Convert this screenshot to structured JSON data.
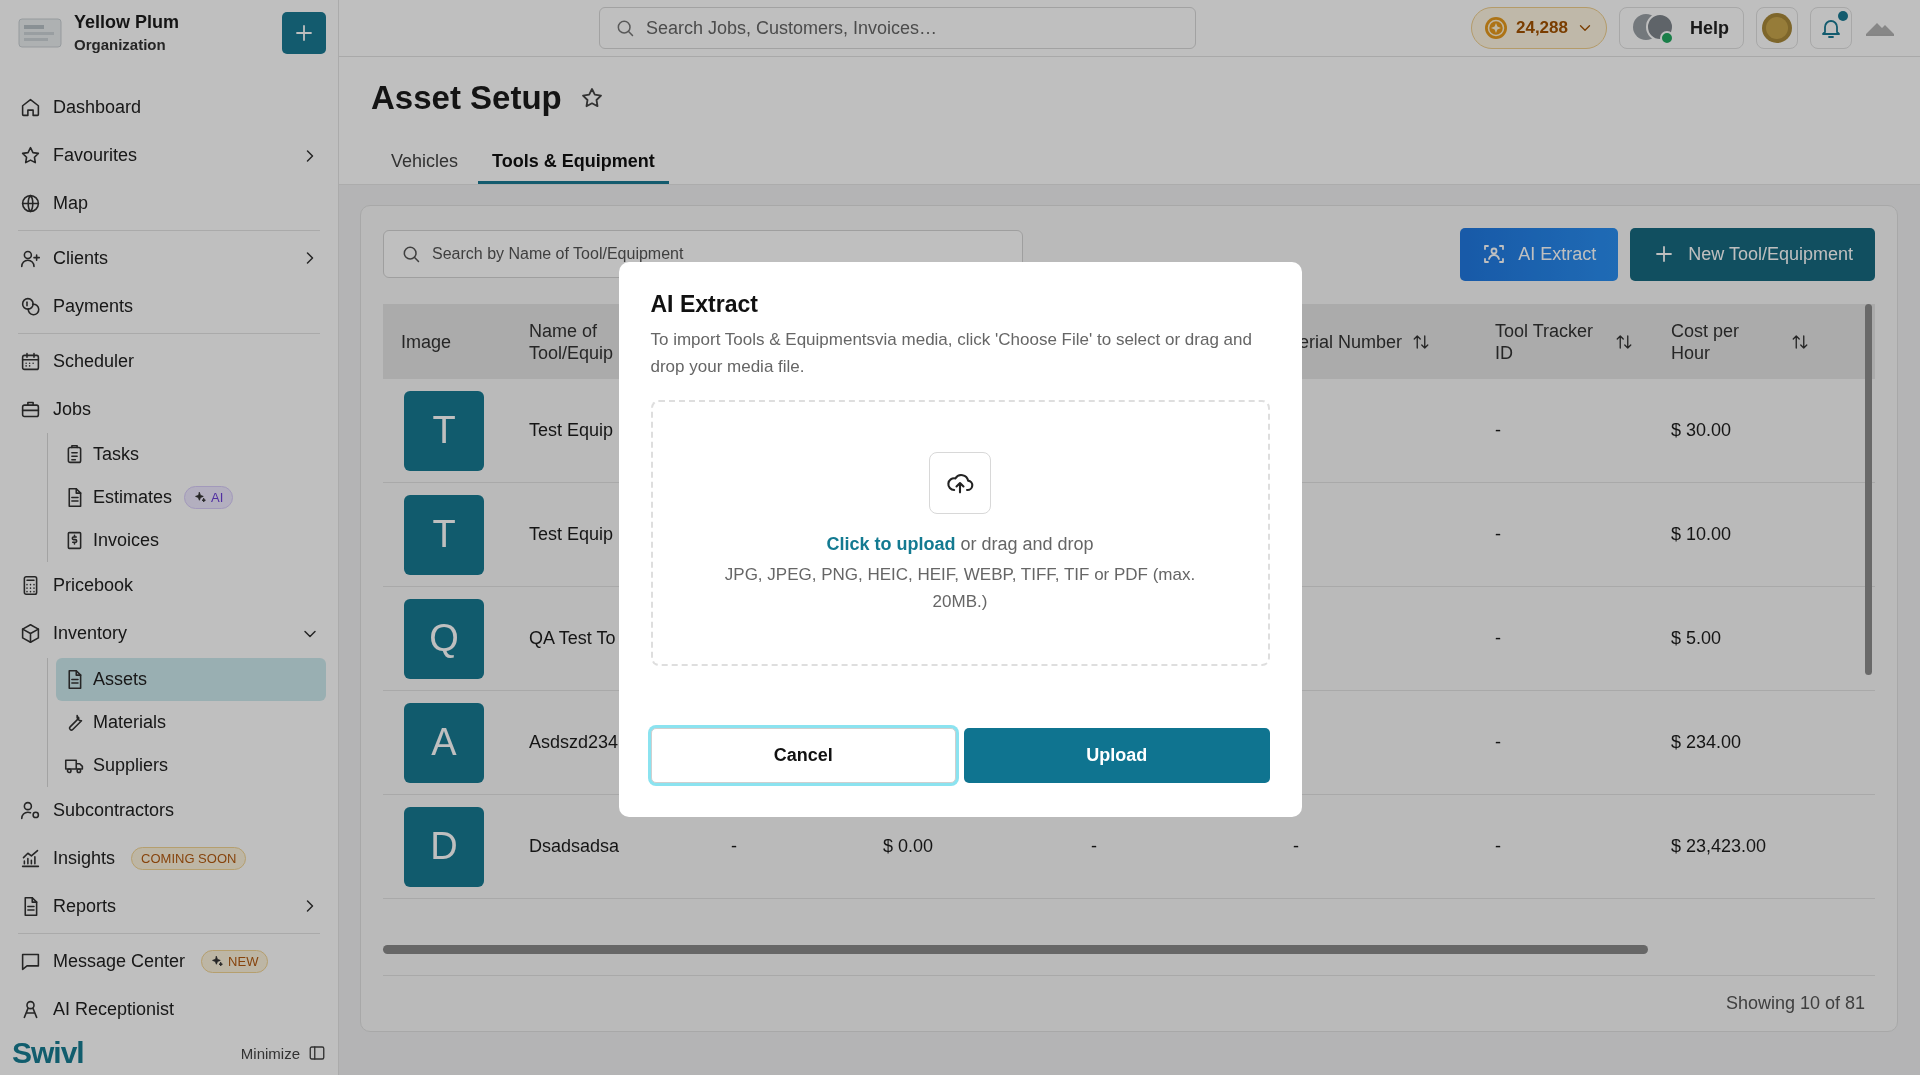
{
  "sidebar": {
    "organization": {
      "name": "Yellow Plum",
      "subtitle": "Organization"
    },
    "sections": [
      {
        "items": [
          {
            "label": "Dashboard",
            "selected": false
          },
          {
            "label": "Favourites",
            "selected": false,
            "expanded": false
          },
          {
            "label": "Map",
            "selected": false
          }
        ]
      },
      {
        "items": [
          {
            "label": "Clients",
            "selected": false,
            "expanded": false
          },
          {
            "label": "Payments",
            "selected": false
          }
        ]
      },
      {
        "items": [
          {
            "label": "Scheduler",
            "selected": false
          },
          {
            "label": "Jobs",
            "selected": false,
            "children": [
              {
                "label": "Tasks",
                "selected": false
              },
              {
                "label": "Estimates",
                "selected": false,
                "badge": {
                  "text": "AI",
                  "kind": "ai"
                }
              },
              {
                "label": "Invoices",
                "selected": false
              }
            ]
          },
          {
            "label": "Pricebook",
            "selected": false
          },
          {
            "label": "Inventory",
            "selected": false,
            "expanded": true,
            "children": [
              {
                "label": "Assets",
                "selected": true
              },
              {
                "label": "Materials",
                "selected": false
              },
              {
                "label": "Suppliers",
                "selected": false
              }
            ]
          },
          {
            "label": "Subcontractors",
            "selected": false
          },
          {
            "label": "Insights",
            "selected": false,
            "badge": {
              "text": "COMING SOON",
              "kind": "soon"
            }
          },
          {
            "label": "Reports",
            "selected": false,
            "expanded": false
          }
        ]
      },
      {
        "items": [
          {
            "label": "Message Center",
            "selected": false,
            "badge": {
              "text": "NEW",
              "kind": "new"
            }
          },
          {
            "label": "AI Receptionist",
            "selected": false
          }
        ]
      }
    ],
    "logo": "Swivl",
    "minimize": "Minimize"
  },
  "topbar": {
    "search": {
      "placeholder": "Search Jobs, Customers, Invoices…"
    },
    "points": "24,288",
    "help": "Help",
    "notifications": {
      "unread": true
    }
  },
  "page": {
    "title": "Asset Setup",
    "favourite": false
  },
  "tabs": [
    {
      "label": "Vehicles",
      "selected": false
    },
    {
      "label": "Tools & Equipment",
      "selected": true
    }
  ],
  "toolbar": {
    "search": {
      "placeholder": "Search by Name of Tool/Equipment"
    },
    "buttons": [
      {
        "label": "AI Extract",
        "kind": "ai"
      },
      {
        "label": "New Tool/Equipment",
        "kind": "new"
      }
    ]
  },
  "table": {
    "columns": {
      "image": {
        "label": "Image",
        "sortable": false
      },
      "name": {
        "label": "Name of Tool/Equip",
        "sortable": false
      },
      "serial_number": {
        "label": "erial Number",
        "sortable": true
      },
      "tool_tracker_id": {
        "label": "Tool Tracker ID",
        "sortable": true
      },
      "cost_per_hour": {
        "label": "Cost per Hour",
        "sortable": true
      }
    },
    "rows": [
      {
        "image": "T",
        "name": "Test Equip",
        "tool_tracker_id": "-",
        "cost_per_hour": "$ 30.00"
      },
      {
        "image": "T",
        "name": "Test Equip",
        "tool_tracker_id": "-",
        "cost_per_hour": "$ 10.00"
      },
      {
        "image": "Q",
        "name": "QA Test To",
        "tool_tracker_id": "-",
        "cost_per_hour": "$ 5.00"
      },
      {
        "image": "A",
        "name": "Asdszd234",
        "tool_tracker_id": "-",
        "cost_per_hour": "$ 234.00"
      },
      {
        "image": "D",
        "name": "Dsadsadsa",
        "column_3": "-",
        "column_4": "$ 0.00",
        "column_5": "-",
        "serial_number": "-",
        "tool_tracker_id": "-",
        "cost_per_hour": "$ 23,423.00"
      }
    ],
    "footer": "Showing 10 of 81"
  },
  "dialog": {
    "title": "AI Extract",
    "description": "To import Tools & Equipmentsvia media, click 'Choose File' to select or drag and drop your media file.",
    "dropzone": {
      "link": "Click to upload",
      "text": "or drag and drop",
      "hint": "JPG, JPEG, PNG, HEIC, HEIF, WEBP, TIFF, TIF or PDF (max. 20MB.)"
    },
    "buttons": [
      {
        "label": "Cancel",
        "kind": "secondary",
        "focused": true
      },
      {
        "label": "Upload",
        "kind": "primary",
        "focused": false
      }
    ]
  }
}
